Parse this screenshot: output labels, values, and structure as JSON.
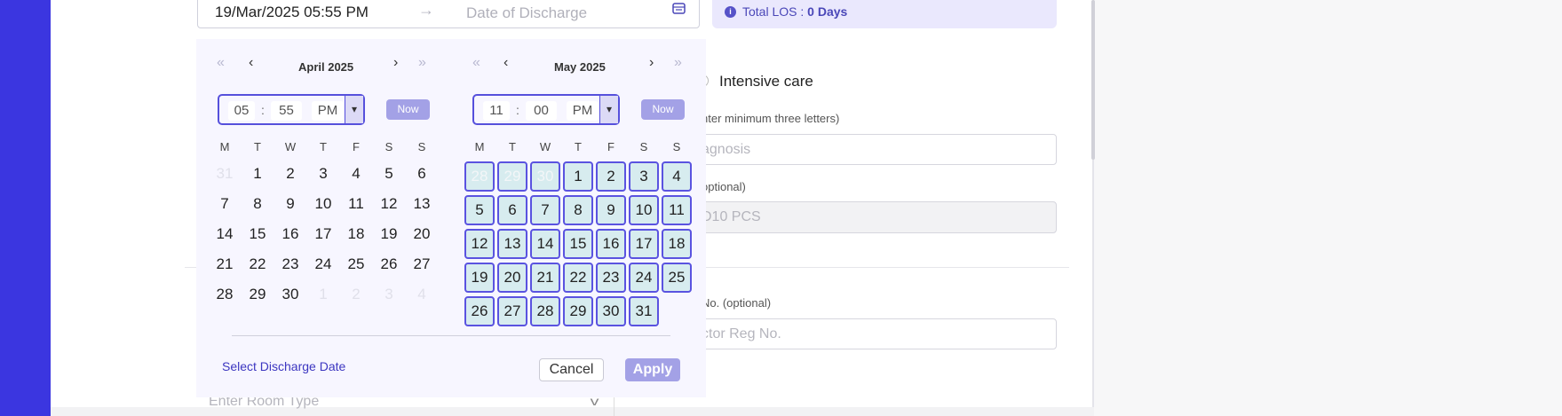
{
  "dates": {
    "start_value": "19/Mar/2025 05:55 PM",
    "end_placeholder": "Date of Discharge"
  },
  "los": {
    "label": "Total LOS : ",
    "value": "0 Days"
  },
  "form": {
    "intensive_care_label": "Intensive care",
    "diagnosis_label": "nter minimum three letters)",
    "diagnosis_placeholder": "agnosis",
    "icd_label": "optional)",
    "icd_placeholder": "D10 PCS",
    "reg_label": "No. (optional)",
    "reg_placeholder": "ctor Reg No.",
    "room_placeholder": "Enter Room Type"
  },
  "calendar": {
    "left": {
      "month_label": "April 2025",
      "hour": "05",
      "minute": "55",
      "ampm": "PM",
      "now_label": "Now",
      "weekdays": [
        "M",
        "T",
        "W",
        "T",
        "F",
        "S",
        "S"
      ],
      "days": [
        [
          "31",
          "1",
          "2",
          "3",
          "4",
          "5",
          "6"
        ],
        [
          "7",
          "8",
          "9",
          "10",
          "11",
          "12",
          "13"
        ],
        [
          "14",
          "15",
          "16",
          "17",
          "18",
          "19",
          "20"
        ],
        [
          "21",
          "22",
          "23",
          "24",
          "25",
          "26",
          "27"
        ],
        [
          "28",
          "29",
          "30",
          "1",
          "2",
          "3",
          "4"
        ]
      ]
    },
    "right": {
      "month_label": "May 2025",
      "hour": "11",
      "minute": "00",
      "ampm": "PM",
      "now_label": "Now",
      "weekdays": [
        "M",
        "T",
        "W",
        "T",
        "F",
        "S",
        "S"
      ],
      "days": [
        [
          "28",
          "29",
          "30",
          "1",
          "2",
          "3",
          "4"
        ],
        [
          "5",
          "6",
          "7",
          "8",
          "9",
          "10",
          "11"
        ],
        [
          "12",
          "13",
          "14",
          "15",
          "16",
          "17",
          "18"
        ],
        [
          "19",
          "20",
          "21",
          "22",
          "23",
          "24",
          "25"
        ],
        [
          "26",
          "27",
          "28",
          "29",
          "30",
          "31"
        ]
      ]
    },
    "nav": {
      "first": "«",
      "prev": "‹",
      "next": "›",
      "last": "»"
    },
    "select_label": "Select Discharge Date",
    "cancel_label": "Cancel",
    "apply_label": "Apply"
  },
  "colors": {
    "sidebar": "#3b36e0",
    "accent": "#5650dc",
    "highlight": "#d7ecef",
    "button": "#a3a1e6"
  }
}
